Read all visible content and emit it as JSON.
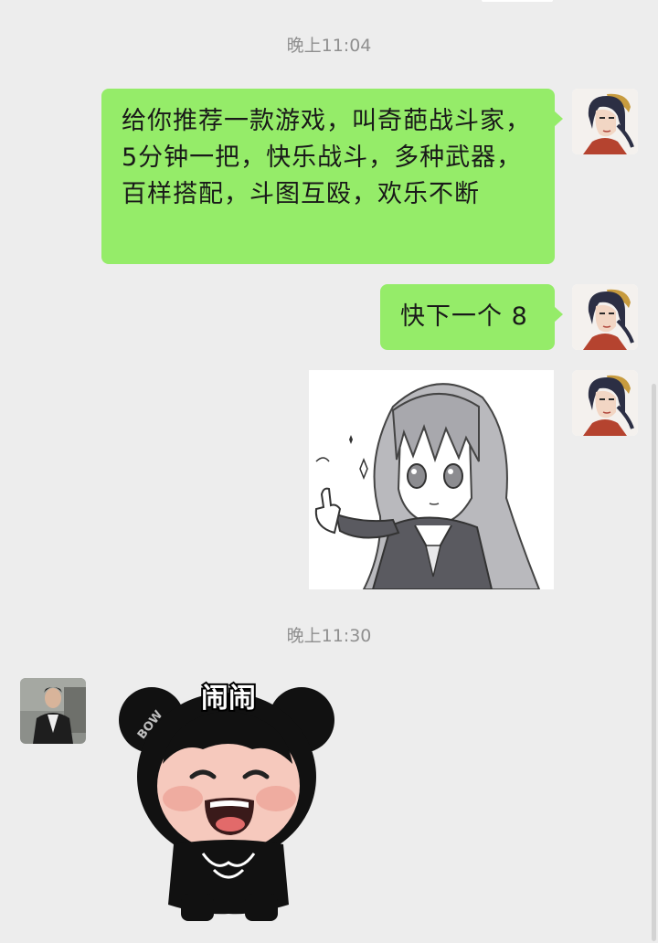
{
  "timestamps": {
    "first": "晚上11:04",
    "second": "晚上11:30"
  },
  "messages": {
    "game_recommendation": "给你推荐一款游戏，叫奇葩战斗家，5分钟一把，快乐战斗，多种武器，百样搭配，斗图互殴，欢乐不断",
    "download_now": "快下一个 8"
  },
  "stickers": {
    "anime_girl": {
      "icon": "anime-girl-thumbs-up-sticker"
    },
    "panda_baby": {
      "caption": "闹闹",
      "badge": "BOW",
      "icon": "panda-baby-sticker"
    }
  },
  "avatars": {
    "self": {
      "icon": "anime-woman-avatar"
    },
    "friend": {
      "icon": "man-photo-avatar"
    }
  },
  "colors": {
    "background": "#ededed",
    "sent_bubble": "#95ec69",
    "timestamp_text": "#8f8f8f",
    "message_text": "#191919"
  }
}
